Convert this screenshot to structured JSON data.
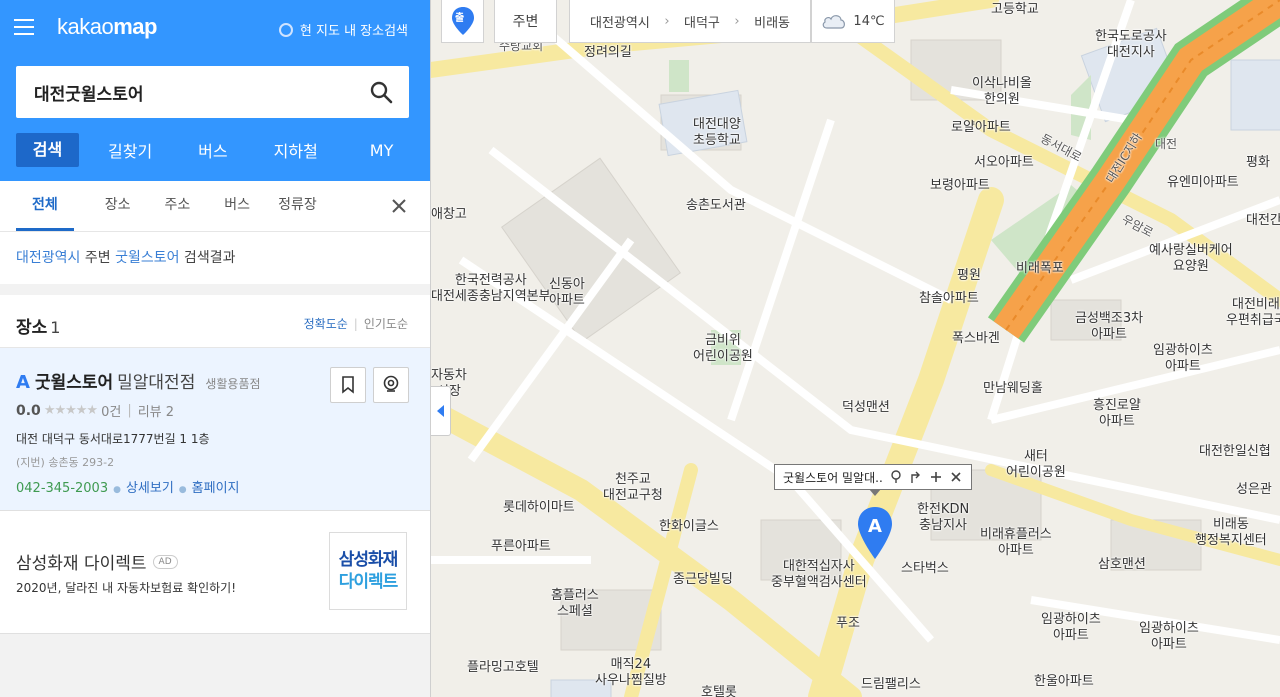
{
  "brand": {
    "logo_light": "kakao",
    "logo_bold": "map",
    "accent": "#3396ff"
  },
  "header": {
    "map_search_label": "현 지도 내 장소검색"
  },
  "search": {
    "value": "대전굿윌스토어"
  },
  "main_tabs": [
    "검색",
    "길찾기",
    "버스",
    "지하철",
    "MY"
  ],
  "sub_tabs": [
    "전체",
    "장소",
    "주소",
    "버스",
    "정류장"
  ],
  "summary": {
    "region": "대전광역시",
    "mid": " 주변 ",
    "keyword": "굿윌스토어",
    "tail": " 검색결과"
  },
  "places": {
    "title": "장소",
    "count": "1",
    "sort_active": "정확도순",
    "sort_other": "인기도순"
  },
  "result": {
    "marker": "A",
    "name_bold": "굿윌스토어",
    "name_rest": "밀알대전점",
    "category": "생활용품점",
    "score": "0.0",
    "stars": "★★★★★",
    "count": "0건",
    "reviews": "리뷰 2",
    "address": "대전 대덕구 동서대로1777번길 1 1층",
    "jibun": "(지번) 송촌동 293-2",
    "phone": "042-345-2003",
    "detail_link": "상세보기",
    "homepage_link": "홈페이지"
  },
  "ad": {
    "title": "삼성화재 다이렉트",
    "badge": "AD",
    "desc": "2020년, 달라진 내 자동차보험료 확인하기!",
    "logo_line1": "삼성화재",
    "logo_line2": "다이렉트"
  },
  "map_toolbar": {
    "nearby_label": "주변",
    "breadcrumb": [
      "대전광역시",
      "대덕구",
      "비래동"
    ],
    "temperature": "14℃",
    "location_badge": "출"
  },
  "infowindow": {
    "title": "굿윌스토어 밀알대.."
  },
  "map_labels": [
    {
      "t": "고등학교"
    },
    {
      "t": "한국도로공사\n대전지사"
    },
    {
      "t": "정려의길"
    },
    {
      "t": "수랑교회"
    },
    {
      "t": "이삭나비올\n한의원"
    },
    {
      "t": "대전대양\n초등학교"
    },
    {
      "t": "로얄아파트"
    },
    {
      "t": "서오아파트"
    },
    {
      "t": "보령아파트"
    },
    {
      "t": "유엔미아파트"
    },
    {
      "t": "평화"
    },
    {
      "t": "송촌도서관"
    },
    {
      "t": "대전간"
    },
    {
      "t": "애창고"
    },
    {
      "t": "예사랑실버케어\n요양원"
    },
    {
      "t": "비래폭포"
    },
    {
      "t": "평원"
    },
    {
      "t": "참솔아파트"
    },
    {
      "t": "한국전력공사\n대전세종충남지역본부"
    },
    {
      "t": "신동아\n아파트"
    },
    {
      "t": "금비위\n어린이공원"
    },
    {
      "t": "대전비래\n우편취급국"
    },
    {
      "t": "금성백조3차\n아파트"
    },
    {
      "t": "폭스바겐"
    },
    {
      "t": "임광하이츠\n아파트"
    },
    {
      "t": "만남웨딩홀"
    },
    {
      "t": "자동차\n시장"
    },
    {
      "t": "덕성맨션"
    },
    {
      "t": "흥진로얄\n아파트"
    },
    {
      "t": "대전한일신협"
    },
    {
      "t": "천주교\n대전교구청"
    },
    {
      "t": "새터\n어린이공원"
    },
    {
      "t": "성은관"
    },
    {
      "t": "롯데하이마트"
    },
    {
      "t": "한화이글스"
    },
    {
      "t": "한전KDN\n충남지사"
    },
    {
      "t": "비래동\n행정복지센터"
    },
    {
      "t": "비래휴플러스\n아파트"
    },
    {
      "t": "푸른아파트"
    },
    {
      "t": "대한적십자사\n중부혈액검사센터"
    },
    {
      "t": "스타벅스"
    },
    {
      "t": "삼호맨션"
    },
    {
      "t": "종근당빌딩"
    },
    {
      "t": "홈플러스\n스페셜"
    },
    {
      "t": "푸조"
    },
    {
      "t": "임광하이츠\n아파트"
    },
    {
      "t": "임광하이츠\n아파트"
    },
    {
      "t": "플라밍고호텔"
    },
    {
      "t": "매직24\n사우나찜질방"
    },
    {
      "t": "드림팰리스"
    },
    {
      "t": "한울아파트"
    },
    {
      "t": "호텔롯"
    },
    {
      "t": "대전"
    },
    {
      "t": "동서대로"
    },
    {
      "t": "우암로"
    },
    {
      "t": "대전IC지하"
    }
  ]
}
